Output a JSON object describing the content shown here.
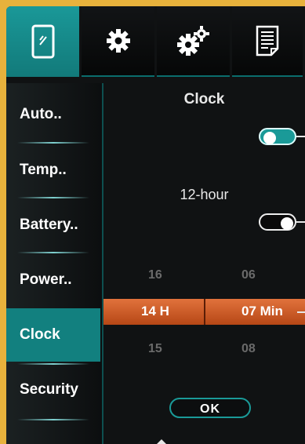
{
  "tabs": [
    {
      "icon": "phone-icon",
      "active": true
    },
    {
      "icon": "gear-icon",
      "active": false
    },
    {
      "icon": "gears-icon",
      "active": false
    },
    {
      "icon": "document-icon",
      "active": false
    }
  ],
  "sidebar": {
    "items": [
      {
        "label": "Auto.."
      },
      {
        "label": "Temp.."
      },
      {
        "label": "Battery.."
      },
      {
        "label": "Power.."
      },
      {
        "label": "Clock"
      },
      {
        "label": "Security"
      }
    ],
    "active_index": 4
  },
  "clock": {
    "title": "Clock",
    "clock_toggle_on": true,
    "hour_format_label": "12-hour",
    "hour_format_on": false
  },
  "time_picker": {
    "hour_prev": "16",
    "hour_current": "14 H",
    "hour_next": "15",
    "minute_prev": "06",
    "minute_current": "07 Min",
    "minute_next": "08"
  },
  "ok_button": {
    "label": "OK"
  },
  "colors": {
    "accent": "#12807f",
    "picker": "#d2602a",
    "frame": "#e8b23c"
  }
}
